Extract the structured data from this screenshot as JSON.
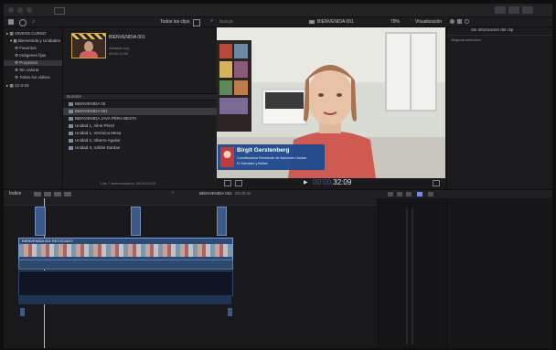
{
  "toolbar": {
    "tool_label": "Todos los clips",
    "search_placeholder": "buscar",
    "project_name": "BIENVENIDA 001",
    "zoom": "79%",
    "view_label": "Visualización"
  },
  "sidebar": {
    "library": "VIDEOS CURSO",
    "event": "Bienvenida y Unidades",
    "items": [
      "Favoritos",
      "Imágenes fijas",
      "Proyectos",
      "Sin valorar",
      "Todos los vídeos"
    ],
    "date_item": "12-3-23"
  },
  "browser": {
    "clip_title": "BIENVENIDA 001",
    "clip_meta_1": "Añadido hoy",
    "clip_meta_2": "00:00:12:00",
    "list_header": "Nombre",
    "rows": [
      "BIENVENIDA 00",
      "BIENVENIDA 001",
      "BIENVENIDA JAVA PÉRA BESTA",
      "Unidad 1, Aline Pérez",
      "Unidad 1, Verónica Mesa",
      "Unidad 2, Alberto Aguilar",
      "Unidad 3, Adrián Dardan"
    ],
    "selected_row_index": 1,
    "footer": "1 de 7 seleccionados, 00:00:12:00"
  },
  "viewer": {
    "name": "Birgit Gerstenberg",
    "role": "Coordinadora Residente de Naciones Unidas",
    "country": "El Salvador y Belice",
    "timecode": "32:09",
    "timecode_prefix": "00:00:"
  },
  "inspector": {
    "title": "Sin información del clip",
    "subtitle": "Ninguna selección"
  },
  "timeline": {
    "index_label": "Índice",
    "project_label": "BIENVENIDA 001",
    "duration": "00:00:32",
    "clip_label": "BIENVENIDA 001 RETOCADO"
  },
  "colors": {
    "accent": "#d6a43a",
    "lower_third": "#1c4b8f",
    "clip_blue": "#3b5a8a"
  }
}
